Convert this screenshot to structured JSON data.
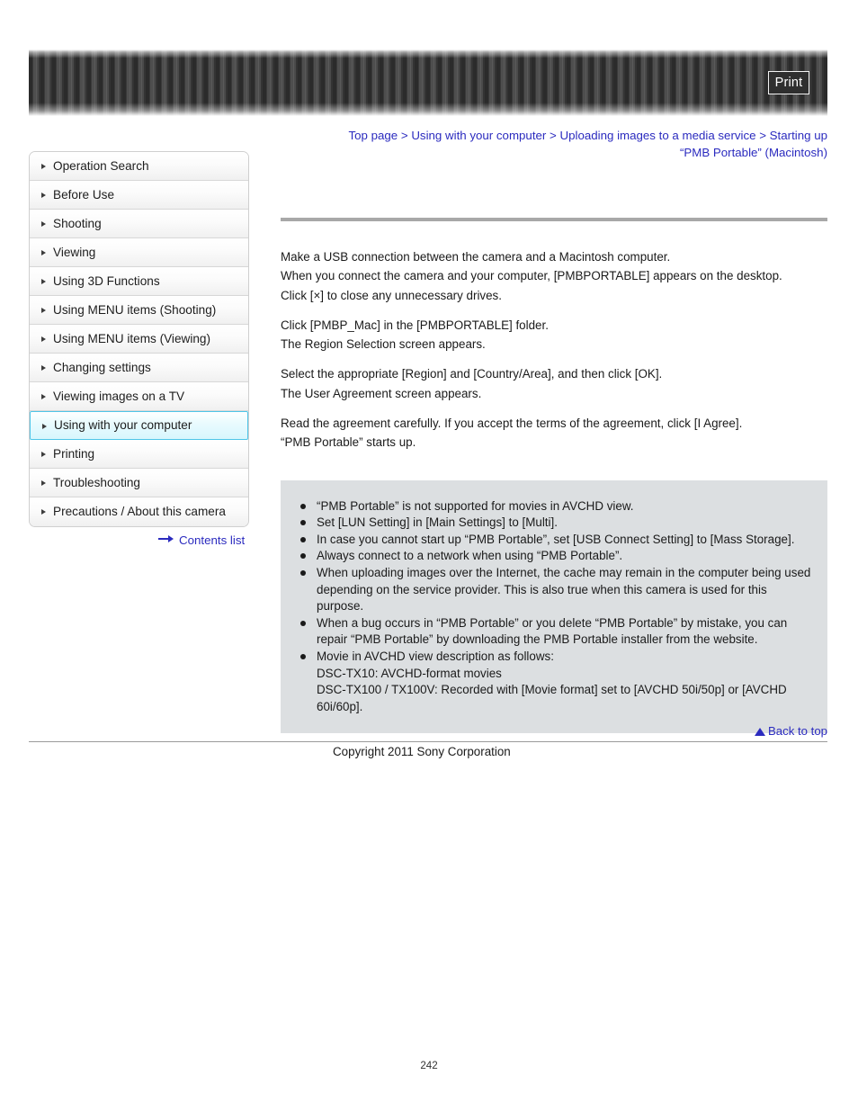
{
  "header": {
    "print_label": "Print"
  },
  "breadcrumb": {
    "line1": "Top page > Using with your computer > Uploading images to a media service > Starting up",
    "line2": "“PMB Portable” (Macintosh)"
  },
  "sidebar": {
    "items": [
      {
        "label": "Operation Search",
        "selected": false
      },
      {
        "label": "Before Use",
        "selected": false
      },
      {
        "label": "Shooting",
        "selected": false
      },
      {
        "label": "Viewing",
        "selected": false
      },
      {
        "label": "Using 3D Functions",
        "selected": false
      },
      {
        "label": "Using MENU items (Shooting)",
        "selected": false
      },
      {
        "label": "Using MENU items (Viewing)",
        "selected": false
      },
      {
        "label": "Changing settings",
        "selected": false
      },
      {
        "label": "Viewing images on a TV",
        "selected": false
      },
      {
        "label": "Using with your computer",
        "selected": true
      },
      {
        "label": "Printing",
        "selected": false
      },
      {
        "label": "Troubleshooting",
        "selected": false
      },
      {
        "label": "Precautions / About this camera",
        "selected": false
      }
    ],
    "contents_link": "Contents list",
    "contents_link_icon": "right-arrow-icon",
    "bullet_icon": "triangle-right-icon"
  },
  "main": {
    "paragraphs": [
      "Make a USB connection between the camera and a Macintosh computer.\nWhen you connect the camera and your computer, [PMBPORTABLE] appears on the desktop.\nClick [×] to close any unnecessary drives.",
      "Click [PMBP_Mac] in the [PMBPORTABLE] folder.\nThe Region Selection screen appears.",
      "Select the appropriate [Region] and [Country/Area], and then click [OK].\nThe User Agreement screen appears.",
      "Read the agreement carefully. If you accept the terms of the agreement, click [I Agree].\n“PMB Portable” starts up."
    ],
    "notes": [
      "“PMB Portable” is not supported for movies in AVCHD view.",
      "Set [LUN Setting] in [Main Settings] to [Multi].",
      "In case you cannot start up “PMB Portable”, set [USB Connect Setting] to [Mass Storage].",
      "Always connect to a network when using “PMB Portable”.",
      "When uploading images over the Internet, the cache may remain in the computer being used depending on the service provider. This is also true when this camera is used for this purpose.",
      "When a bug occurs in “PMB Portable” or you delete “PMB Portable” by mistake, you can repair “PMB Portable” by downloading the PMB Portable installer from the website.",
      "Movie in AVCHD view description as follows:\nDSC-TX10: AVCHD-format movies\nDSC-TX100 / TX100V: Recorded with [Movie format] set to [AVCHD 50i/50p] or [AVCHD 60i/60p]."
    ]
  },
  "footer": {
    "back_to_top": "Back to top",
    "back_to_top_icon": "triangle-up-icon",
    "copyright": "Copyright 2011 Sony Corporation",
    "page_number": "242"
  },
  "colors": {
    "link": "#2b2bbf",
    "selected_border": "#4fc5e8",
    "note_box_bg": "#dcdfe1",
    "rule": "#a8a8a8"
  }
}
